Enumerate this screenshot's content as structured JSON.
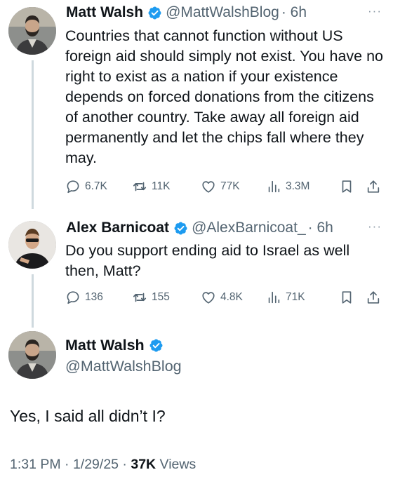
{
  "tweets": [
    {
      "author": "Matt Walsh",
      "handle": "@MattWalshBlog",
      "time": "· 6h",
      "text": "Countries that cannot function without US foreign aid should simply not exist. You have no right to exist as a nation if your existence depends on forced donations from the citizens of another country. Take away all foreign aid permanently and let the chips fall where they may.",
      "replies": "6.7K",
      "reposts": "11K",
      "likes": "77K",
      "views": "3.3M"
    },
    {
      "author": "Alex Barnicoat",
      "handle": "@AlexBarnicoat_",
      "time": "· 6h",
      "text": "Do you support ending aid to Israel as well then, Matt?",
      "replies": "136",
      "reposts": "155",
      "likes": "4.8K",
      "views": "71K"
    }
  ],
  "main": {
    "author": "Matt Walsh",
    "handle": "@MattWalshBlog",
    "text": "Yes, I said all didn’t I?",
    "timestamp": "1:31 PM · 1/29/25 · ",
    "views_count": "37K",
    "views_label": " Views"
  },
  "more_label": "···",
  "colors": {
    "verified": "#1d9bf0",
    "secondary": "#536471",
    "thread_line": "#cfd9de"
  },
  "icons": [
    "verified-badge-icon",
    "reply-icon",
    "repost-icon",
    "like-icon",
    "views-icon",
    "bookmark-icon",
    "share-icon"
  ]
}
